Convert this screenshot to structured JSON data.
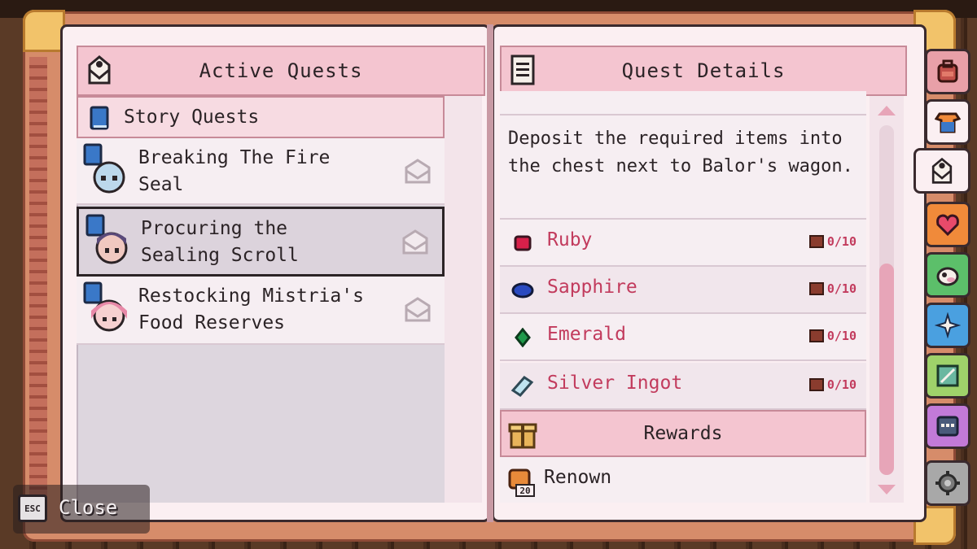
{
  "left_panel": {
    "header": "Active Quests",
    "category": "Story Quests",
    "quests": [
      {
        "title_line1": "Breaking The Fire",
        "title_line2": "Seal",
        "selected": false
      },
      {
        "title_line1": "Procuring the",
        "title_line2": "Sealing Scroll",
        "selected": true
      },
      {
        "title_line1": "Restocking Mistria's",
        "title_line2": "Food Reserves",
        "selected": false
      }
    ]
  },
  "right_panel": {
    "header": "Quest Details",
    "description": "Deposit the required items into the chest next to Balor's wagon.",
    "items": [
      {
        "name": "Ruby",
        "count": "0/10",
        "icon": "ruby-icon",
        "color": "#d8204a"
      },
      {
        "name": "Sapphire",
        "count": "0/10",
        "icon": "sapphire-icon",
        "color": "#2a4ac0"
      },
      {
        "name": "Emerald",
        "count": "0/10",
        "icon": "emerald-icon",
        "color": "#1e9a4a"
      },
      {
        "name": "Silver Ingot",
        "count": "0/10",
        "icon": "silver-ingot-icon",
        "color": "#bfe4f0"
      }
    ],
    "rewards_header": "Rewards",
    "rewards": [
      {
        "name": "Renown",
        "amount": "20"
      }
    ]
  },
  "tabs": [
    {
      "icon": "backpack-icon",
      "color": "#e8a0a8"
    },
    {
      "icon": "outfit-icon",
      "color": "#fbeff2"
    },
    {
      "icon": "quest-icon",
      "color": "#fbeff2",
      "active": true
    },
    {
      "icon": "heart-icon",
      "color": "#f08a3a"
    },
    {
      "icon": "animal-icon",
      "color": "#5cbf6a"
    },
    {
      "icon": "sparkle-icon",
      "color": "#4aa0e0"
    },
    {
      "icon": "map-icon",
      "color": "#9fd26a"
    },
    {
      "icon": "journal-icon",
      "color": "#c27ad8"
    },
    {
      "icon": "settings-icon",
      "color": "#a8a8a8"
    }
  ],
  "close": {
    "key": "ESC",
    "label": "Close"
  }
}
